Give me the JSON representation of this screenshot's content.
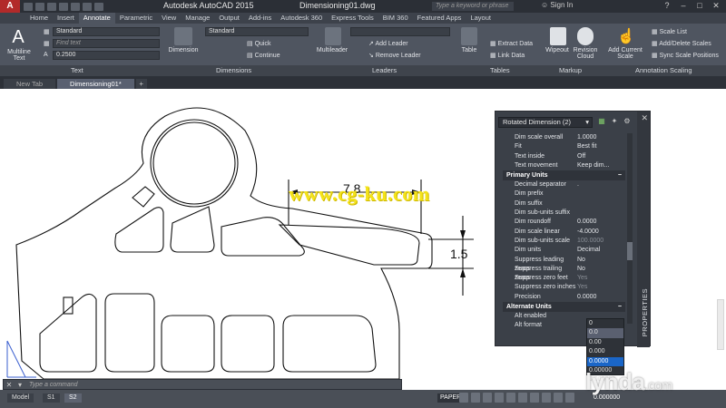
{
  "titlebar": {
    "app_title": "Autodesk AutoCAD 2015",
    "file_title": "Dimensioning01.dwg",
    "search_placeholder": "Type a keyword or phrase",
    "signin_label": "Sign In",
    "logo_letter": "A"
  },
  "ribbon_tabs": [
    {
      "label": "Home"
    },
    {
      "label": "Insert"
    },
    {
      "label": "Annotate",
      "active": true
    },
    {
      "label": "Parametric"
    },
    {
      "label": "View"
    },
    {
      "label": "Manage"
    },
    {
      "label": "Output"
    },
    {
      "label": "Add-ins"
    },
    {
      "label": "Autodesk 360"
    },
    {
      "label": "Express Tools"
    },
    {
      "label": "BIM 360"
    },
    {
      "label": "Featured Apps"
    },
    {
      "label": "Layout"
    }
  ],
  "ribbon": {
    "text_panel": {
      "title": "Text",
      "multiline_label": "Multiline Text",
      "style_value": "Standard",
      "find_placeholder": "Find text",
      "height_value": "0.2500"
    },
    "dimensions_panel": {
      "title": "Dimensions",
      "dimension_label": "Dimension",
      "style_value": "Standard",
      "quick_label": "Quick",
      "continue_label": "Continue"
    },
    "leaders_panel": {
      "title": "Leaders",
      "multileader_label": "Multileader",
      "add_leader_label": "Add Leader",
      "remove_leader_label": "Remove Leader"
    },
    "tables_panel": {
      "title": "Tables",
      "table_label": "Table",
      "extract_label": "Extract Data",
      "link_label": "Link Data"
    },
    "markup_panel": {
      "title": "Markup",
      "wipeout_label": "Wipeout",
      "revision_label": "Revision Cloud"
    },
    "scaling_panel": {
      "title": "Annotation Scaling",
      "add_current_label": "Add Current Scale",
      "scale_list_label": "Scale List",
      "add_delete_label": "Add/Delete Scales",
      "sync_label": "Sync Scale Positions"
    }
  },
  "doc_tabs": [
    {
      "label": "New Tab"
    },
    {
      "label": "Dimensioning01*",
      "active": true
    }
  ],
  "drawing": {
    "dim_horizontal": "7.8",
    "dim_vertical": "1.5",
    "watermark": "www.cg-ku.com"
  },
  "properties": {
    "selection": "Rotated Dimension (2)",
    "side_title": "PROPERTIES",
    "rows_top": [
      {
        "key": "Dim scale overall",
        "value": "1.0000"
      },
      {
        "key": "Fit",
        "value": "Best fit"
      },
      {
        "key": "Text inside",
        "value": "Off"
      },
      {
        "key": "Text movement",
        "value": "Keep dim..."
      }
    ],
    "section_primary": "Primary Units",
    "rows_primary": [
      {
        "key": "Decimal separator",
        "value": "."
      },
      {
        "key": "Dim prefix",
        "value": ""
      },
      {
        "key": "Dim suffix",
        "value": ""
      },
      {
        "key": "Dim sub-units suffix",
        "value": ""
      },
      {
        "key": "Dim roundoff",
        "value": "0.0000"
      },
      {
        "key": "Dim scale linear",
        "value": "-4.0000"
      },
      {
        "key": "Dim sub-units scale",
        "value": "100.0000",
        "dim": true
      },
      {
        "key": "Dim units",
        "value": "Decimal"
      },
      {
        "key": "Suppress leading zeros",
        "value": "No"
      },
      {
        "key": "Suppress trailing zeros",
        "value": "No"
      },
      {
        "key": "Suppress zero feet",
        "value": "Yes",
        "dim": true
      },
      {
        "key": "Suppress zero inches",
        "value": "Yes",
        "dim": true
      },
      {
        "key": "Precision",
        "value": "0.0000"
      }
    ],
    "section_alternate": "Alternate Units",
    "rows_alternate": [
      {
        "key": "Alt enabled",
        "value": ""
      },
      {
        "key": "Alt format",
        "value": ""
      }
    ]
  },
  "precision_dropdown": {
    "options": [
      "0",
      "0.0",
      "0.00",
      "0.000",
      "0.0000",
      "0.00000",
      "0.000000"
    ],
    "selected_index": 4,
    "hover_index": 1
  },
  "command_line": {
    "placeholder": "Type a command"
  },
  "status": {
    "layout_tabs": [
      {
        "label": "Model"
      },
      {
        "label": "S1"
      },
      {
        "label": "S2",
        "active": true
      }
    ],
    "paper_label": "PAPER",
    "scale_value": "0.000000"
  },
  "branding": {
    "lynda": "lynda",
    "lynda_suffix": ".com"
  }
}
